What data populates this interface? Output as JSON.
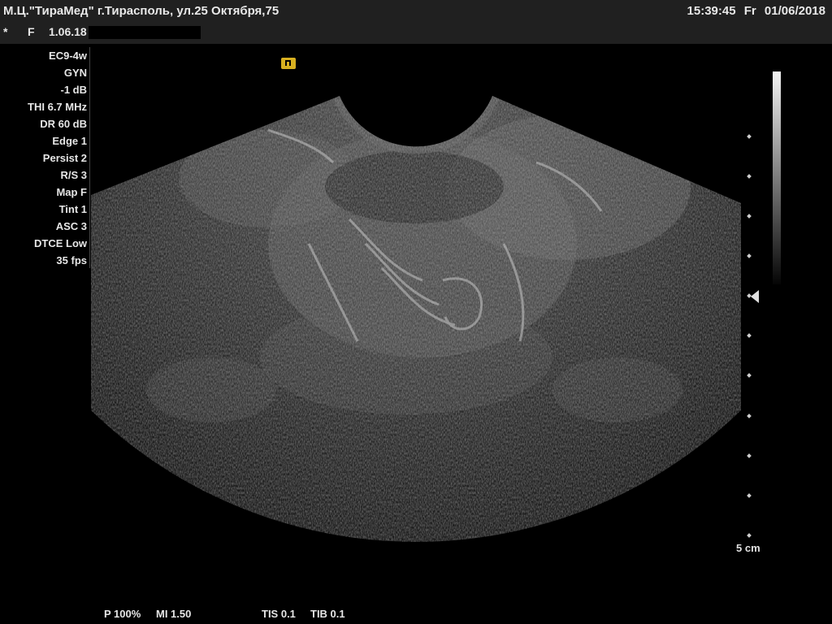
{
  "header": {
    "clinic": "М.Ц.\"ТираМед\" г.Тирасполь, ул.25 Октября,75",
    "time": "15:39:45",
    "weekday": "Fr",
    "date": "01/06/2018"
  },
  "patient": {
    "mark": "*",
    "sex": "F",
    "exam_date": "1.06.18"
  },
  "params": [
    "EC9-4w",
    "GYN",
    "-1 dB",
    "THI 6.7 MHz",
    "DR 60 dB",
    "Edge 1",
    "Persist 2",
    "R/S 3",
    "Map F",
    "Tint 1",
    "ASC 3",
    "DTCE Low",
    "35 fps"
  ],
  "depth_scale": {
    "label": "5 cm"
  },
  "footer": {
    "power": "P 100%",
    "mi": "MI 1.50",
    "tis": "TIS 0.1",
    "tib": "TIB 0.1"
  },
  "colors": {
    "orientation_marker": "#d8b020",
    "header_bg": "#202020"
  }
}
